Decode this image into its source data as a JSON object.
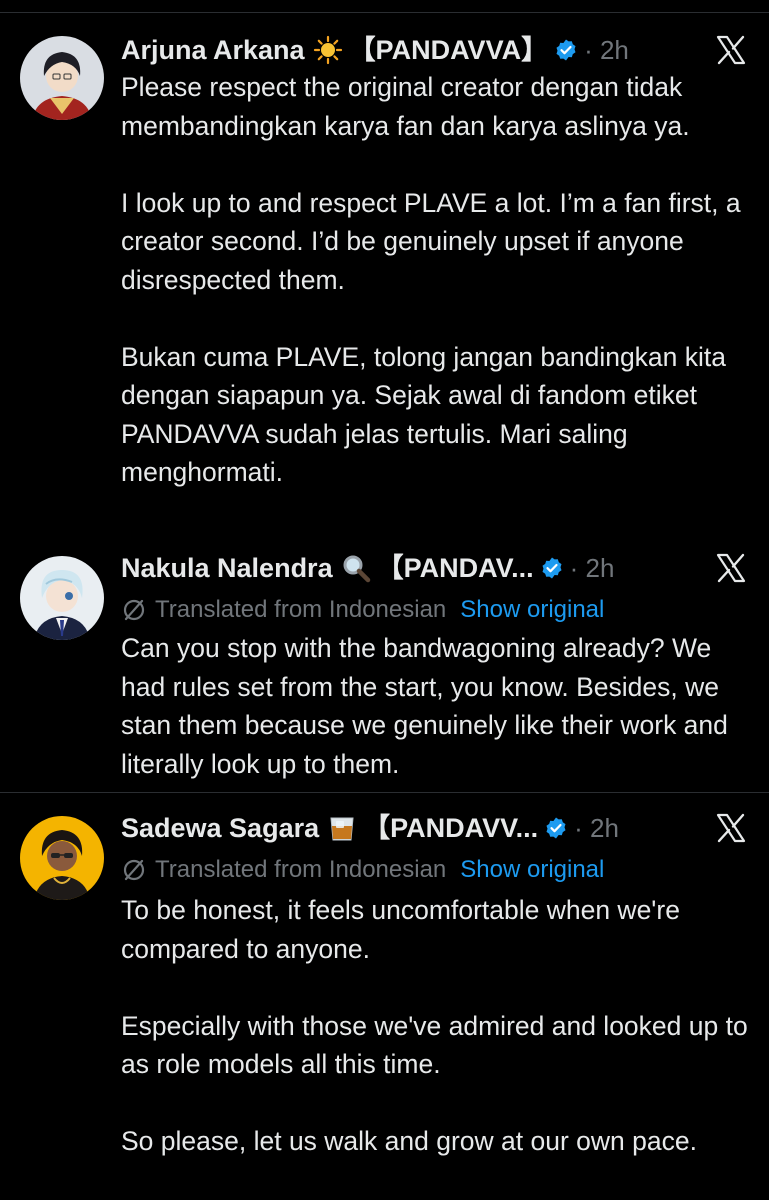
{
  "posts": [
    {
      "author": "Arjuna Arkana",
      "emoji": "sun-emoji",
      "tag": "【PANDAVVA】",
      "time": "· 2h",
      "paragraphs": [
        "Please respect the original creator dengan tidak membandingkan karya fan dan karya aslinya ya.",
        "I look up to and respect PLAVE a lot. I’m a fan first, a creator second. I’d be genuinely upset if anyone disrespected them.",
        "Bukan cuma PLAVE, tolong jangan bandingkan kita dengan siapapun ya. Sejak awal di fandom etiket PANDAVVA sudah jelas tertulis. Mari saling menghormati."
      ]
    },
    {
      "author": "Nakula Nalendra",
      "emoji": "magnifying-glass-emoji",
      "tag": "【PANDAV...",
      "time": "· 2h",
      "translated_label": "Translated from Indonesian",
      "show_original_label": "Show original",
      "paragraphs": [
        "Can you stop with the bandwagoning already? We had rules set from the start, you know. Besides, we stan them because we genuinely like their work and literally look up to them."
      ]
    },
    {
      "author": "Sadewa Sagara",
      "emoji": "whisky-glass-emoji",
      "tag": "【PANDAVV...",
      "time": "· 2h",
      "translated_label": "Translated from Indonesian",
      "show_original_label": "Show original",
      "paragraphs": [
        "To be honest, it feels uncomfortable when we're compared to anyone.",
        "Especially with those we've admired and looked up to as role models all this time.",
        "So please, let us walk and grow at our own pace."
      ]
    }
  ],
  "colors": {
    "background": "#000000",
    "text": "#e7e9ea",
    "muted": "#71767b",
    "link": "#1d9bf0",
    "verified": "#1d9bf0"
  }
}
